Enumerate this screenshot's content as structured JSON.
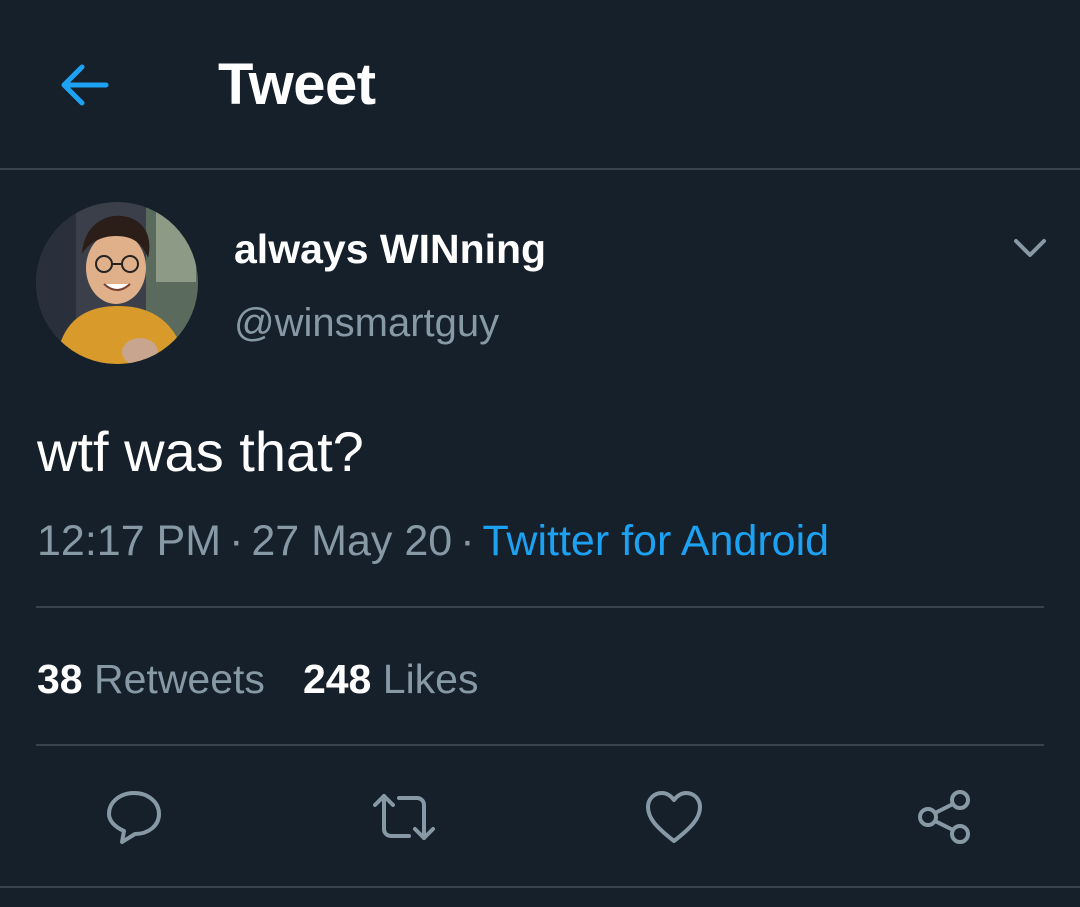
{
  "header": {
    "back_icon": "arrow-left-icon",
    "title": "Tweet"
  },
  "tweet": {
    "author": {
      "display_name": "always WINning",
      "handle": "@winsmartguy",
      "avatar": "profile-photo"
    },
    "text": "wtf was that?",
    "meta": {
      "time": "12:17 PM",
      "separator": "·",
      "date": "27 May 20",
      "source": "Twitter for Android"
    },
    "stats": {
      "retweets_count": "38",
      "retweets_label": "Retweets",
      "likes_count": "248",
      "likes_label": "Likes"
    },
    "actions": [
      "reply-icon",
      "retweet-icon",
      "like-icon",
      "share-icon"
    ]
  },
  "colors": {
    "background": "#15202b",
    "divider": "#38444d",
    "accent": "#1da1f2",
    "secondary_text": "#8899a6",
    "primary_text": "#ffffff"
  }
}
